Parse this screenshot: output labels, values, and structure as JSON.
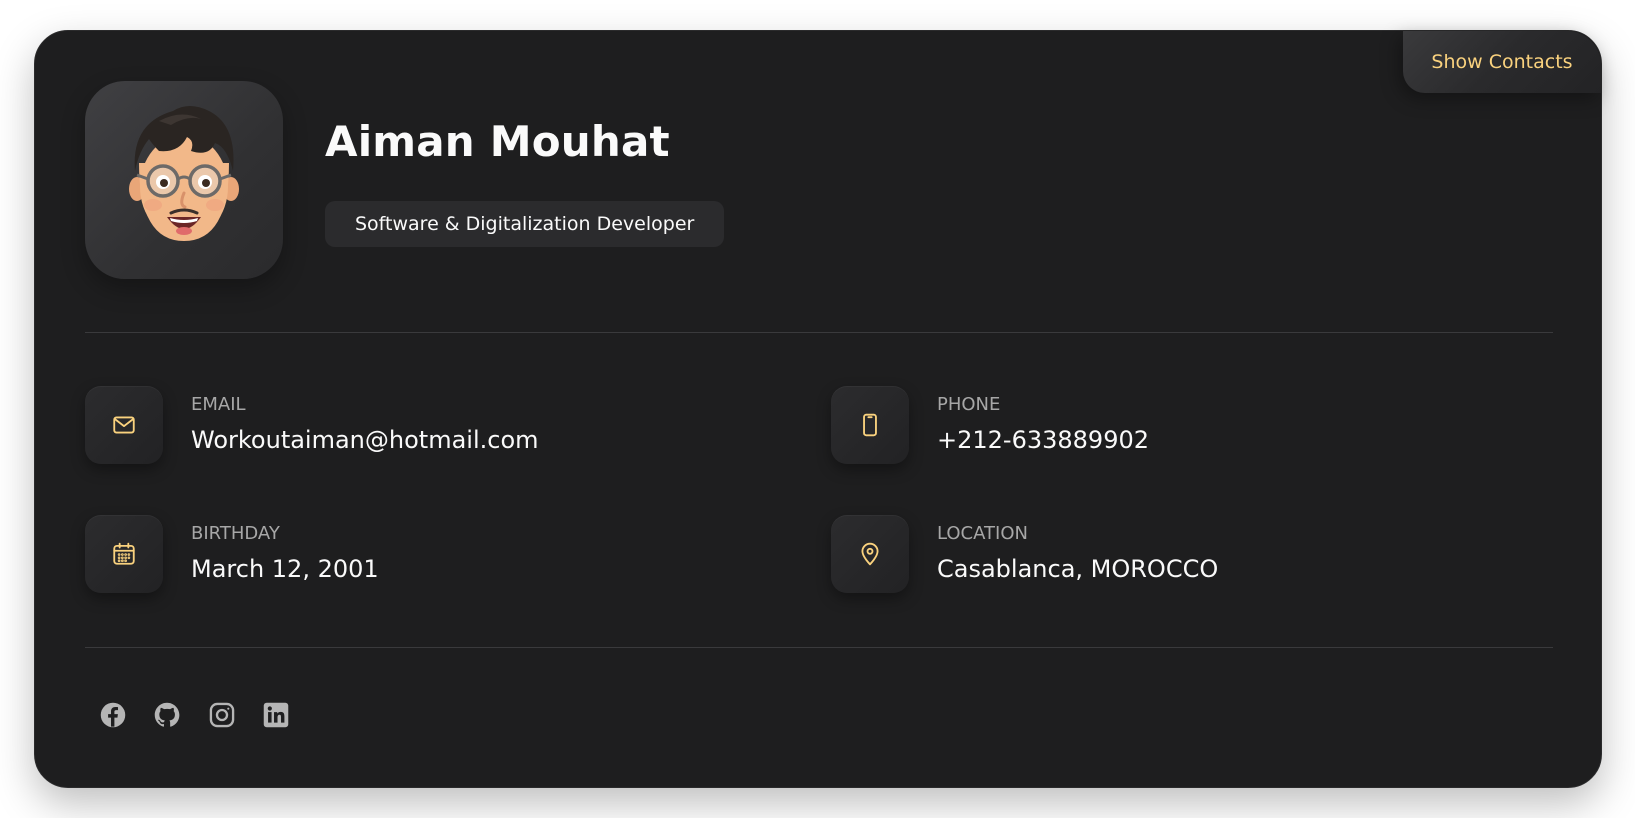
{
  "profile": {
    "name": "Aiman Mouhat",
    "title": "Software & Digitalization Developer",
    "show_contacts_label": "Show Contacts"
  },
  "contacts": {
    "email": {
      "label": "EMAIL",
      "value": "Workoutaiman@hotmail.com",
      "icon": "mail-icon"
    },
    "phone": {
      "label": "PHONE",
      "value": "+212-633889902",
      "icon": "smartphone-icon"
    },
    "birthday": {
      "label": "BIRTHDAY",
      "value": "March 12, 2001",
      "icon": "calendar-icon"
    },
    "location": {
      "label": "LOCATION",
      "value": "Casablanca, MOROCCO",
      "icon": "map-pin-icon"
    }
  },
  "socials": [
    {
      "name": "facebook-icon"
    },
    {
      "name": "github-icon"
    },
    {
      "name": "instagram-icon"
    },
    {
      "name": "linkedin-icon"
    }
  ],
  "colors": {
    "card_background": "#1e1e1f",
    "accent": "#fad27e",
    "text_primary": "#fafafa",
    "text_secondary": "#a7a7a7",
    "social_icon": "#b5b5b5"
  }
}
